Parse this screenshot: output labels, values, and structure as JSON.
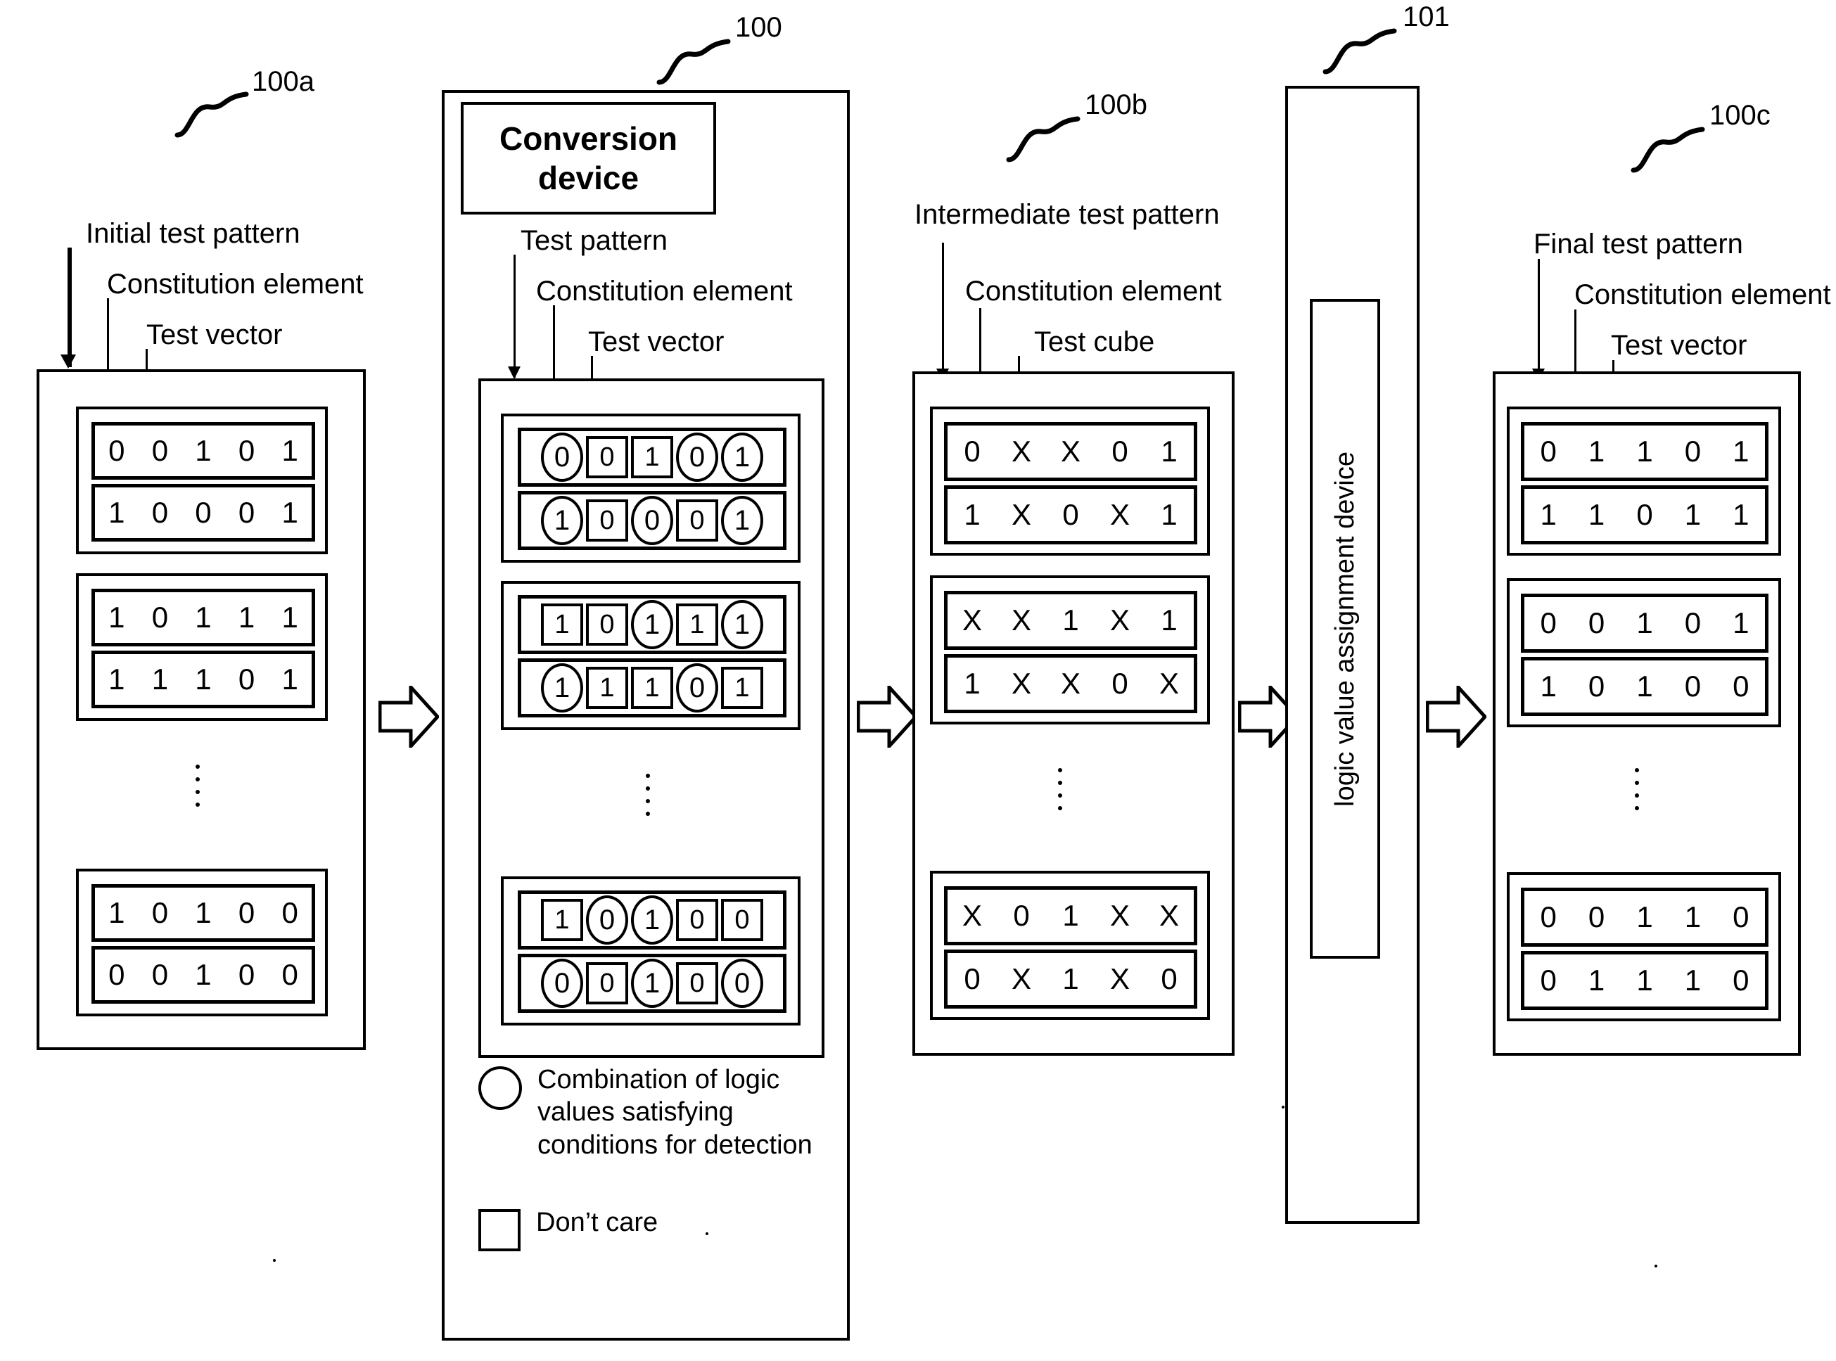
{
  "figure": {
    "refs": {
      "initial": "100a",
      "conversion": "100",
      "intermediate": "100b",
      "assignment": "101",
      "final": "100c"
    },
    "title_conversion": "Conversion\ndevice",
    "title_assignment": "logic value assignment device"
  },
  "columns": [
    {
      "id": "initial",
      "ref": "100a",
      "labels": {
        "pattern": "Initial test pattern",
        "element": "Constitution element",
        "vector": "Test vector"
      },
      "marked": false,
      "groups": [
        {
          "rows": [
            [
              "0",
              "0",
              "1",
              "0",
              "1"
            ],
            [
              "1",
              "0",
              "0",
              "0",
              "1"
            ]
          ]
        },
        {
          "rows": [
            [
              "1",
              "0",
              "1",
              "1",
              "1"
            ],
            [
              "1",
              "1",
              "1",
              "0",
              "1"
            ]
          ]
        },
        {
          "rows": [
            [
              "1",
              "0",
              "1",
              "0",
              "0"
            ],
            [
              "0",
              "0",
              "1",
              "0",
              "0"
            ]
          ]
        }
      ]
    },
    {
      "id": "conversion",
      "ref": "100",
      "title": "Conversion device",
      "labels": {
        "pattern": "Test pattern",
        "element": "Constitution element",
        "vector": "Test vector"
      },
      "marked": true,
      "groups": [
        {
          "rows": [
            [
              {
                "v": "0",
                "m": "circle"
              },
              {
                "v": "0",
                "m": "box"
              },
              {
                "v": "1",
                "m": "box"
              },
              {
                "v": "0",
                "m": "circle"
              },
              {
                "v": "1",
                "m": "circle"
              }
            ],
            [
              {
                "v": "1",
                "m": "circle"
              },
              {
                "v": "0",
                "m": "box"
              },
              {
                "v": "0",
                "m": "circle"
              },
              {
                "v": "0",
                "m": "box"
              },
              {
                "v": "1",
                "m": "circle"
              }
            ]
          ]
        },
        {
          "rows": [
            [
              {
                "v": "1",
                "m": "box"
              },
              {
                "v": "0",
                "m": "box"
              },
              {
                "v": "1",
                "m": "circle"
              },
              {
                "v": "1",
                "m": "box"
              },
              {
                "v": "1",
                "m": "circle"
              }
            ],
            [
              {
                "v": "1",
                "m": "circle"
              },
              {
                "v": "1",
                "m": "box"
              },
              {
                "v": "1",
                "m": "box"
              },
              {
                "v": "0",
                "m": "circle"
              },
              {
                "v": "1",
                "m": "box"
              }
            ]
          ]
        },
        {
          "rows": [
            [
              {
                "v": "1",
                "m": "box"
              },
              {
                "v": "0",
                "m": "circle"
              },
              {
                "v": "1",
                "m": "circle"
              },
              {
                "v": "0",
                "m": "box"
              },
              {
                "v": "0",
                "m": "box"
              }
            ],
            [
              {
                "v": "0",
                "m": "circle"
              },
              {
                "v": "0",
                "m": "box"
              },
              {
                "v": "1",
                "m": "circle"
              },
              {
                "v": "0",
                "m": "box"
              },
              {
                "v": "0",
                "m": "circle"
              }
            ]
          ]
        }
      ],
      "legend": [
        {
          "icon": "circle-icon",
          "text": "Combination of  logic values  satisfying conditions for detection"
        },
        {
          "icon": "square-icon",
          "text": "Don’t care"
        }
      ]
    },
    {
      "id": "intermediate",
      "ref": "100b",
      "labels": {
        "pattern": "Intermediate test pattern",
        "element": "Constitution element",
        "vector": "Test cube"
      },
      "marked": false,
      "groups": [
        {
          "rows": [
            [
              "0",
              "X",
              "X",
              "0",
              "1"
            ],
            [
              "1",
              "X",
              "0",
              "X",
              "1"
            ]
          ]
        },
        {
          "rows": [
            [
              "X",
              "X",
              "1",
              "X",
              "1"
            ],
            [
              "1",
              "X",
              "X",
              "0",
              "X"
            ]
          ]
        },
        {
          "rows": [
            [
              "X",
              "0",
              "1",
              "X",
              "X"
            ],
            [
              "0",
              "X",
              "1",
              "X",
              "0"
            ]
          ]
        }
      ]
    },
    {
      "id": "final",
      "ref": "100c",
      "labels": {
        "pattern": "Final test pattern",
        "element": "Constitution element",
        "vector": "Test vector"
      },
      "marked": false,
      "groups": [
        {
          "rows": [
            [
              "0",
              "1",
              "1",
              "0",
              "1"
            ],
            [
              "1",
              "1",
              "0",
              "1",
              "1"
            ]
          ]
        },
        {
          "rows": [
            [
              "0",
              "0",
              "1",
              "0",
              "1"
            ],
            [
              "1",
              "0",
              "1",
              "0",
              "0"
            ]
          ]
        },
        {
          "rows": [
            [
              "0",
              "0",
              "1",
              "1",
              "0"
            ],
            [
              "0",
              "1",
              "1",
              "1",
              "0"
            ]
          ]
        }
      ]
    }
  ],
  "assignment_device": {
    "ref": "101",
    "label": "logic value assignment device"
  },
  "colors": {
    "ink": "#000000",
    "paper": "#ffffff"
  }
}
